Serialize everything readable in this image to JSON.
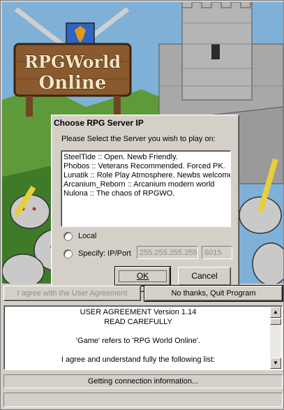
{
  "artwork": {
    "logo_line1": "RPGWorld",
    "logo_line2": "Online"
  },
  "dialog": {
    "title": "Choose RPG Server IP",
    "prompt": "Please Select the Server you wish to play on:",
    "servers": [
      "SteelTide :: Open. Newb Friendly.",
      "Phobos :: Veterans Recommended. Forced PK.",
      "Lunatik :: Role Play Atmosphere. Newbs welcome.",
      "Arcanium_Reborn :: Arcanium modern world",
      "Nulona :: The chaos of RPGWO."
    ],
    "radio_local": "Local",
    "radio_specify": "Specify: IP/Port",
    "ip_value": "255.255.255.255",
    "port_value": "6015",
    "ok_label": "OK",
    "cancel_label": "Cancel"
  },
  "main": {
    "agree_label": "I agree with the User Agreement",
    "quit_label": "No thanks, Quit Program",
    "agreement_lines": [
      "USER AGREEMENT Version 1.14",
      "READ CAREFULLY",
      "",
      "'Game' refers to 'RPG World Online'.",
      "",
      "I agree and understand fully the following list:"
    ],
    "status_text": "Getting connection information...",
    "progress_fraction": 0
  },
  "colors": {
    "face": "#d4d0c8",
    "disabled_text": "#8e8e8e",
    "sky": "#7fb0d8",
    "castle": "#a8a8a8",
    "grass": "#5f9a3a",
    "wood": "#8a5a2e"
  }
}
